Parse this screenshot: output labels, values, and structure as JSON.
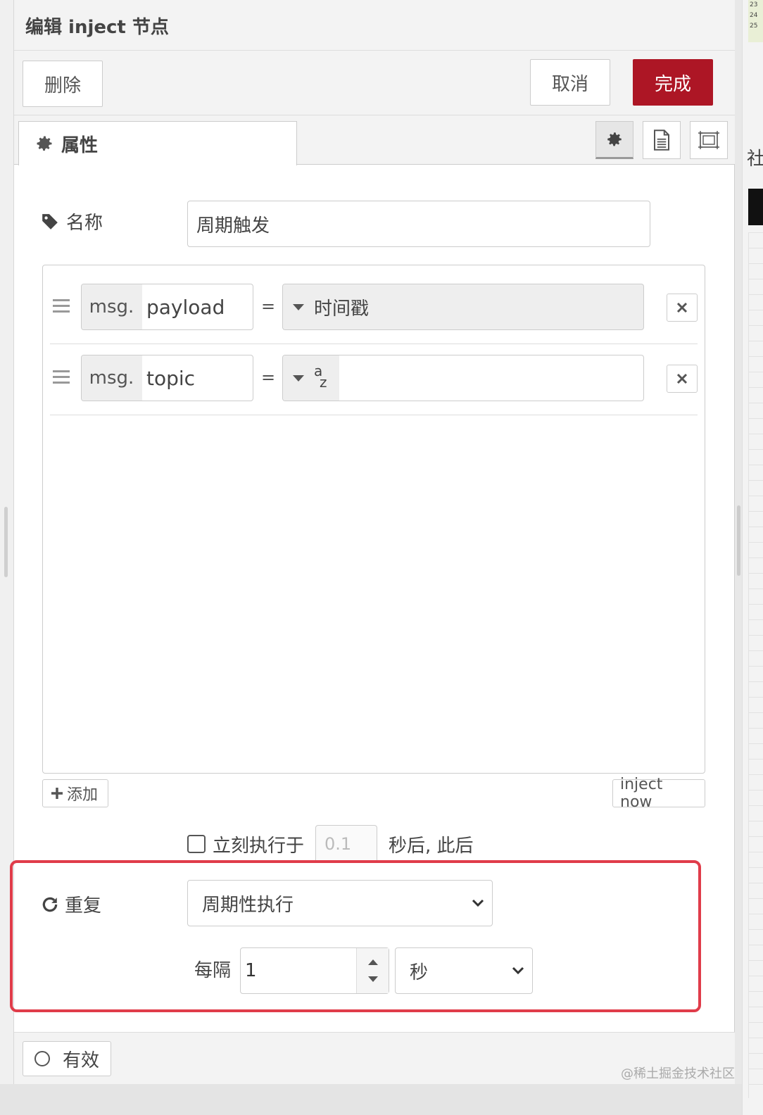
{
  "dialog": {
    "title": "编辑 inject 节点"
  },
  "toolbar": {
    "delete_label": "删除",
    "cancel_label": "取消",
    "done_label": "完成"
  },
  "tabs": {
    "properties_label": "属性",
    "icons": [
      "gear-icon",
      "document-icon",
      "frame-icon"
    ]
  },
  "form": {
    "name_label": "名称",
    "name_value": "周期触发",
    "properties": [
      {
        "prefix": "msg.",
        "key": "payload",
        "operator": "=",
        "type_label": "时间戳",
        "value": ""
      },
      {
        "prefix": "msg.",
        "key": "topic",
        "operator": "=",
        "type_label": "a z",
        "value": ""
      }
    ],
    "add_label": "添加",
    "inject_now_label": "inject now",
    "once": {
      "label": "立刻执行于",
      "value": "0.1",
      "suffix": "秒后, 此后"
    },
    "repeat": {
      "label": "重复",
      "selected": "周期性执行",
      "every_label": "每隔",
      "interval_value": "1",
      "unit_selected": "秒"
    }
  },
  "footer": {
    "enabled_label": "有效",
    "watermark": "@稀土掘金技术社区"
  },
  "background": {
    "mini_lines": [
      "23",
      "24",
      "25"
    ],
    "fragment_text": "社"
  },
  "colors": {
    "done_button": "#ad1625",
    "highlight_border": "#e03c4a"
  }
}
